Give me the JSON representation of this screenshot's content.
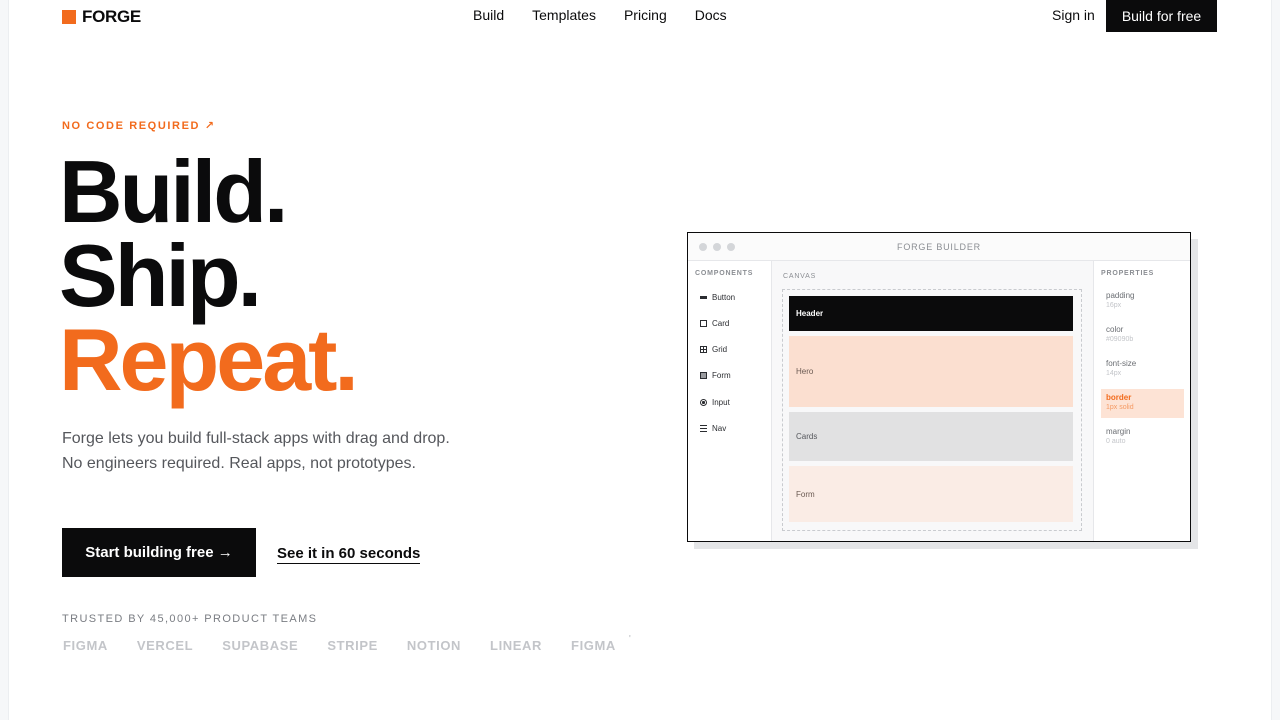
{
  "nav": {
    "logo": "FORGE",
    "links": [
      "Build",
      "Templates",
      "Pricing",
      "Docs"
    ],
    "sign_in": "Sign in",
    "cta": "Build for free"
  },
  "hero": {
    "eyebrow": "NO CODE REQUIRED ↗",
    "line1": "Build.",
    "line2": "Ship.",
    "line3": "Repeat.",
    "subtitle": "Forge lets you build full-stack apps with drag and drop. No engineers required. Real apps, not prototypes.",
    "primary_cta": "Start building free →",
    "secondary_cta": "See it in 60 seconds",
    "trusted_label": "TRUSTED BY 45,000+ PRODUCT TEAMS",
    "logos": [
      "FIGMA",
      "VERCEL",
      "SUPABASE",
      "STRIPE",
      "NOTION",
      "LINEAR",
      "FIGMA"
    ],
    "logos_tail": "'"
  },
  "builder": {
    "title": "FORGE BUILDER",
    "components_heading": "COMPONENTS",
    "components": [
      {
        "label": "Button",
        "icon": "button-icon"
      },
      {
        "label": "Card",
        "icon": "card-icon"
      },
      {
        "label": "Grid",
        "icon": "grid-icon"
      },
      {
        "label": "Form",
        "icon": "form-icon"
      },
      {
        "label": "Input",
        "icon": "input-icon"
      },
      {
        "label": "Nav",
        "icon": "nav-icon"
      }
    ],
    "canvas_heading": "CANVAS",
    "blocks": [
      "Header",
      "Hero",
      "Cards",
      "Form"
    ],
    "properties_heading": "PROPERTIES",
    "properties": [
      {
        "key": "padding",
        "value": "16px"
      },
      {
        "key": "color",
        "value": "#09090b"
      },
      {
        "key": "font-size",
        "value": "14px"
      },
      {
        "key": "border",
        "value": "1px solid"
      },
      {
        "key": "margin",
        "value": "0 auto"
      }
    ],
    "active_property": "border"
  },
  "colors": {
    "accent": "#f26b1d",
    "ink": "#0b0b0c"
  }
}
